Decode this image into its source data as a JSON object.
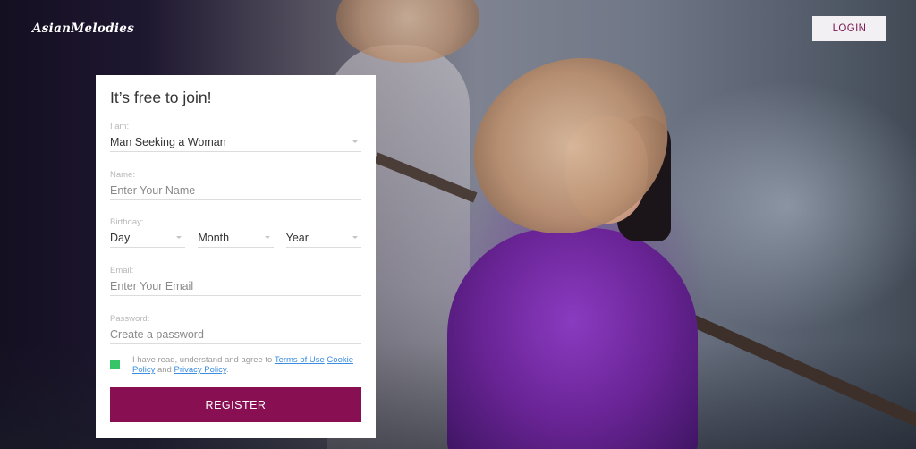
{
  "header": {
    "logo_text": "AsianMelodies",
    "login_label": "LOGIN"
  },
  "form": {
    "title": "It’s free to join!",
    "iam": {
      "label": "I am:",
      "value": "Man Seeking a Woman"
    },
    "name": {
      "label": "Name:",
      "placeholder": "Enter Your Name"
    },
    "birthday": {
      "label": "Birthday:",
      "day": "Day",
      "month": "Month",
      "year": "Year"
    },
    "email": {
      "label": "Email:",
      "placeholder": "Enter Your Email"
    },
    "password": {
      "label": "Password:",
      "placeholder": "Create a password"
    },
    "consent": {
      "checked": true,
      "text_prefix": "I have read, understand and agree to ",
      "terms_link": "Terms of Use",
      "cookie_link": "Cookie Policy",
      "and_text": " and ",
      "privacy_link": "Privacy Policy",
      "suffix": "."
    },
    "register_label": "REGISTER"
  },
  "colors": {
    "brand": "#870f52",
    "checkbox": "#35c468",
    "link": "#3a8de0"
  }
}
